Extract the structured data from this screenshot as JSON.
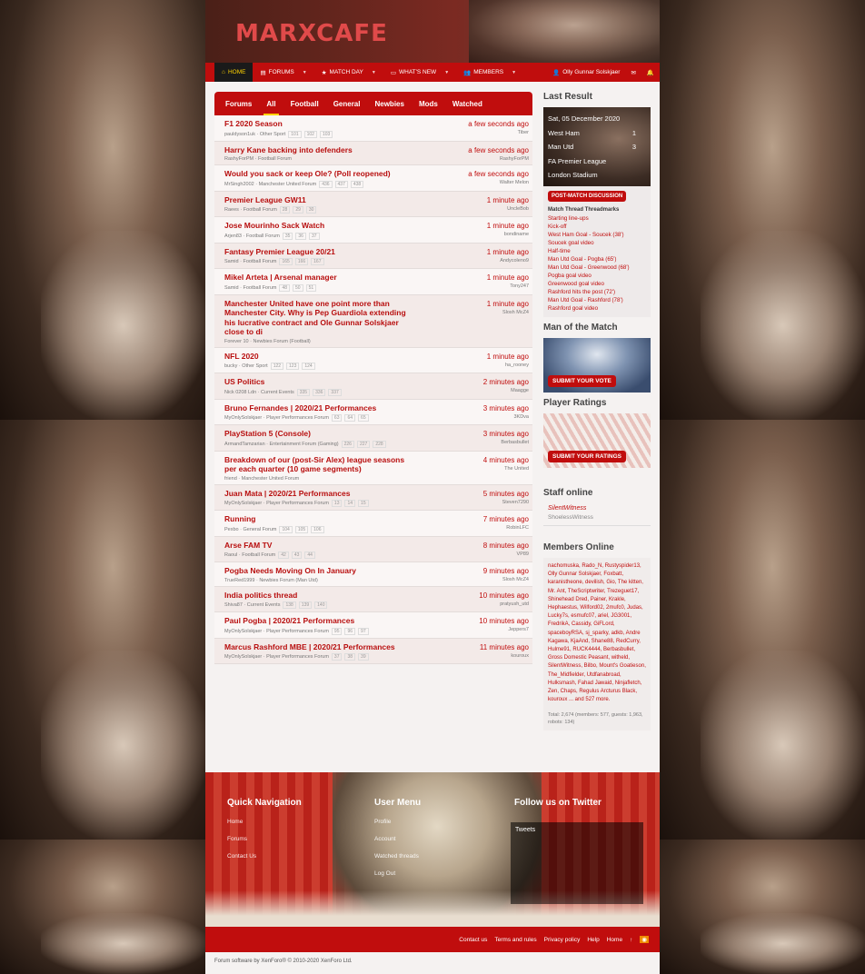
{
  "site": {
    "logo": "MARXCAFE"
  },
  "nav": {
    "home": "HOME",
    "forums": "FORUMS",
    "matchday": "MATCH DAY",
    "whatsnew": "WHAT'S NEW",
    "members": "MEMBERS",
    "user": "Olly Gunnar Solskjaer"
  },
  "tabs": [
    "Forums",
    "All",
    "Football",
    "General",
    "Newbies",
    "Mods",
    "Watched"
  ],
  "threads": [
    {
      "title": "F1 2020 Season",
      "meta": "pauldyson1uk · Other Sport",
      "pages": [
        "101",
        "102",
        "103"
      ],
      "time": "a few seconds ago",
      "last": "Tiber"
    },
    {
      "title": "Harry Kane backing into defenders",
      "meta": "RashyForPM · Football Forum",
      "pages": [],
      "time": "a few seconds ago",
      "last": "RashyForPM"
    },
    {
      "title": "Would you sack or keep Ole? (Poll reopened)",
      "meta": "MrSingh2002 · Manchester United Forum",
      "pages": [
        "436",
        "437",
        "438"
      ],
      "time": "a few seconds ago",
      "last": "Walter Melon"
    },
    {
      "title": "Premier League GW11",
      "meta": "Raees · Football Forum",
      "pages": [
        "28",
        "29",
        "30"
      ],
      "time": "1 minute ago",
      "last": "UncleBob"
    },
    {
      "title": "Jose Mourinho Sack Watch",
      "meta": "Arjen83 · Football Forum",
      "pages": [
        "35",
        "36",
        "37"
      ],
      "time": "1 minute ago",
      "last": "bondiname"
    },
    {
      "title": "Fantasy Premier League 20/21",
      "meta": "Samid · Football Forum",
      "pages": [
        "165",
        "166",
        "167"
      ],
      "time": "1 minute ago",
      "last": "Andycoleno9"
    },
    {
      "title": "Mikel Arteta | Arsenal manager",
      "meta": "Samid · Football Forum",
      "pages": [
        "48",
        "50",
        "51"
      ],
      "time": "1 minute ago",
      "last": "Tony247"
    },
    {
      "title": "Manchester United have one point more than Manchester City. Why is Pep Guardiola extending his lucrative contract and Ole Gunnar Solskjaer close to di",
      "meta": "Forever 10 · Newbies Forum (Football)",
      "pages": [],
      "time": "1 minute ago",
      "last": "Slosh McZ4"
    },
    {
      "title": "NFL 2020",
      "meta": "bucky · Other Sport",
      "pages": [
        "122",
        "123",
        "124"
      ],
      "time": "1 minute ago",
      "last": "ha_rooney"
    },
    {
      "title": "US Politics",
      "meta": "Nick 0208 Ldn · Current Events",
      "pages": [
        "335",
        "336",
        "337"
      ],
      "time": "2 minutes ago",
      "last": "Maagge"
    },
    {
      "title": "Bruno Fernandes | 2020/21 Performances",
      "meta": "MyOnlySolskjaer · Player Performances Forum",
      "pages": [
        "63",
        "64",
        "65"
      ],
      "time": "3 minutes ago",
      "last": "3KDva"
    },
    {
      "title": "PlayStation 5 (Console)",
      "meta": "ArmandTamzarian · Entertainment Forum (Gaming)",
      "pages": [
        "226",
        "227",
        "228"
      ],
      "time": "3 minutes ago",
      "last": "Berbasbullet"
    },
    {
      "title": "Breakdown of our (post-Sir Alex) league seasons per each quarter (10 game segments)",
      "meta": "friend · Manchester United Forum",
      "pages": [],
      "time": "4 minutes ago",
      "last": "The United"
    },
    {
      "title": "Juan Mata | 2020/21 Performances",
      "meta": "MyOnlySolskjaer · Player Performances Forum",
      "pages": [
        "13",
        "14",
        "15"
      ],
      "time": "5 minutes ago",
      "last": "Steven7290"
    },
    {
      "title": "Running",
      "meta": "Pexbo · General Forum",
      "pages": [
        "104",
        "105",
        "106"
      ],
      "time": "7 minutes ago",
      "last": "RobinLFC"
    },
    {
      "title": "Arse FAM TV",
      "meta": "Raoul · Football Forum",
      "pages": [
        "42",
        "43",
        "44"
      ],
      "time": "8 minutes ago",
      "last": "VP89"
    },
    {
      "title": "Pogba Needs Moving On In January",
      "meta": "TrueRed1999 · Newbies Forum (Man Utd)",
      "pages": [],
      "time": "9 minutes ago",
      "last": "Slosh McZ4"
    },
    {
      "title": "India politics thread",
      "meta": "Shiva87 · Current Events",
      "pages": [
        "138",
        "139",
        "140"
      ],
      "time": "10 minutes ago",
      "last": "pratyush_utd"
    },
    {
      "title": "Paul Pogba | 2020/21 Performances",
      "meta": "MyOnlySolskjaer · Player Performances Forum",
      "pages": [
        "95",
        "96",
        "97"
      ],
      "time": "10 minutes ago",
      "last": "Jeppers7"
    },
    {
      "title": "Marcus Rashford MBE | 2020/21 Performances",
      "meta": "MyOnlySolskjaer · Player Performances Forum",
      "pages": [
        "37",
        "38",
        "39"
      ],
      "time": "11 minutes ago",
      "last": "kouroux"
    }
  ],
  "sidebar": {
    "last_result": "Last Result",
    "result": {
      "date": "Sat, 05 December 2020",
      "home": "West Ham",
      "home_score": "1",
      "away": "Man Utd",
      "away_score": "3",
      "comp": "FA Premier League",
      "venue": "London Stadium"
    },
    "post_match": "POST-MATCH DISCUSSION",
    "threadmarks_title": "Match Thread Threadmarks",
    "threadmarks": [
      "Starting line-ups",
      "Kick-off",
      "West Ham Goal - Soucek (38')",
      "Soucek goal video",
      "Half-time",
      "Man Utd Goal - Pogba (65')",
      "Man Utd Goal - Greenwood (68')",
      "Pogba goal video",
      "Greenwood goal video",
      "Rashford hits the post (72')",
      "Man Utd Goal - Rashford (78')",
      "Rashford goal video"
    ],
    "motm": "Man of the Match",
    "motm_btn": "SUBMIT YOUR VOTE",
    "ratings": "Player Ratings",
    "ratings_btn": "SUBMIT YOUR RATINGS",
    "staff": "Staff online",
    "staff_1": "SilentWitness",
    "staff_2": "ShoelessWitness",
    "members_online": "Members Online",
    "members_text": "nachomuska, Rado_N, Rustyspider13, Olly Gunnar Solskjaer, Foxbatt, karanistheone, devilish, Gio, The kitten, Mr. Ant, TheScriptwriter, Trezeguet17, Shinehead Dred, Painer, Krakle, Hephaestus, Wilford02, 2mufc0, Judas, Lucky7s, esmufc07, ariel, JG3001, FredrikA, Cassidy, GiFLord, spaceboyRSA, sj_sparky, adkb, Andre Kagawa, KjaAnd, Shane88, RedCurry, Hulme91, RUCK4444, Berbasbullet, Gross Domestic Peasant, witheld, SilentWitness, Bilbo, Mount's Goatieson, The_Midfielder, Utdfanabroad, Hulksmash, Fahad Jawaid, Ninjafletch, Zen, Chaps, Regulus Arcturus Black, kouroux ... and 527 more.",
    "total": "Total: 2,674 (members: 577, guests: 1,963, robots: 134)"
  },
  "footer": {
    "quick_nav": "Quick Navigation",
    "qn": [
      "Home",
      "Forums",
      "Contact Us"
    ],
    "user_menu": "User Menu",
    "um": [
      "Profile",
      "Account",
      "Watched threads",
      "Log Out"
    ],
    "follow": "Follow us on Twitter",
    "tweets": "Tweets",
    "links": [
      "Contact us",
      "Terms and rules",
      "Privacy policy",
      "Help",
      "Home"
    ],
    "copyright": "Forum software by XenForo® © 2010-2020 XenForo Ltd."
  }
}
